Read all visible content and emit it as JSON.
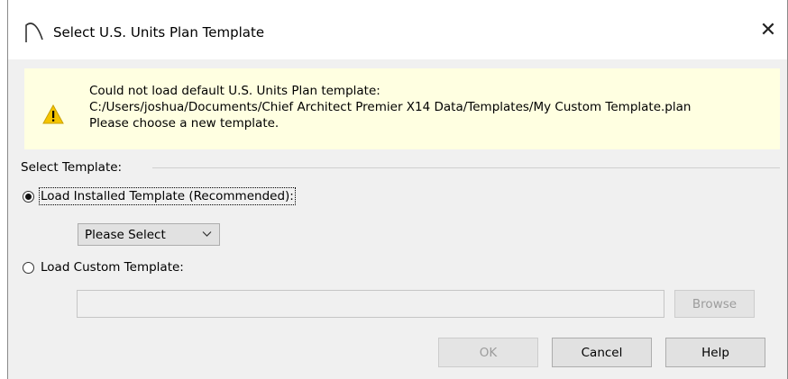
{
  "window": {
    "title": "Select U.S. Units Plan Template",
    "close_glyph": "✕",
    "app_icon": "chief-architect-arc-icon"
  },
  "warning": {
    "icon": "warning-triangle-icon",
    "line1": "Could not load default U.S. Units Plan template:",
    "line2": "C:/Users/joshua/Documents/Chief Architect Premier X14 Data/Templates/My Custom Template.plan",
    "line3": "Please choose a new template."
  },
  "group": {
    "label": "Select Template:"
  },
  "options": {
    "installed": {
      "label": "Load Installed Template (Recommended):",
      "selected": true
    },
    "custom": {
      "label": "Load Custom Template:",
      "selected": false
    }
  },
  "template_select": {
    "value": "Please Select"
  },
  "custom_path": {
    "value": ""
  },
  "buttons": {
    "browse": "Browse",
    "ok": "OK",
    "cancel": "Cancel",
    "help": "Help"
  },
  "colors": {
    "warning_bg": "#ffffe1",
    "warning_icon": "#f5c400",
    "dialog_bg": "#f0f0f0"
  }
}
